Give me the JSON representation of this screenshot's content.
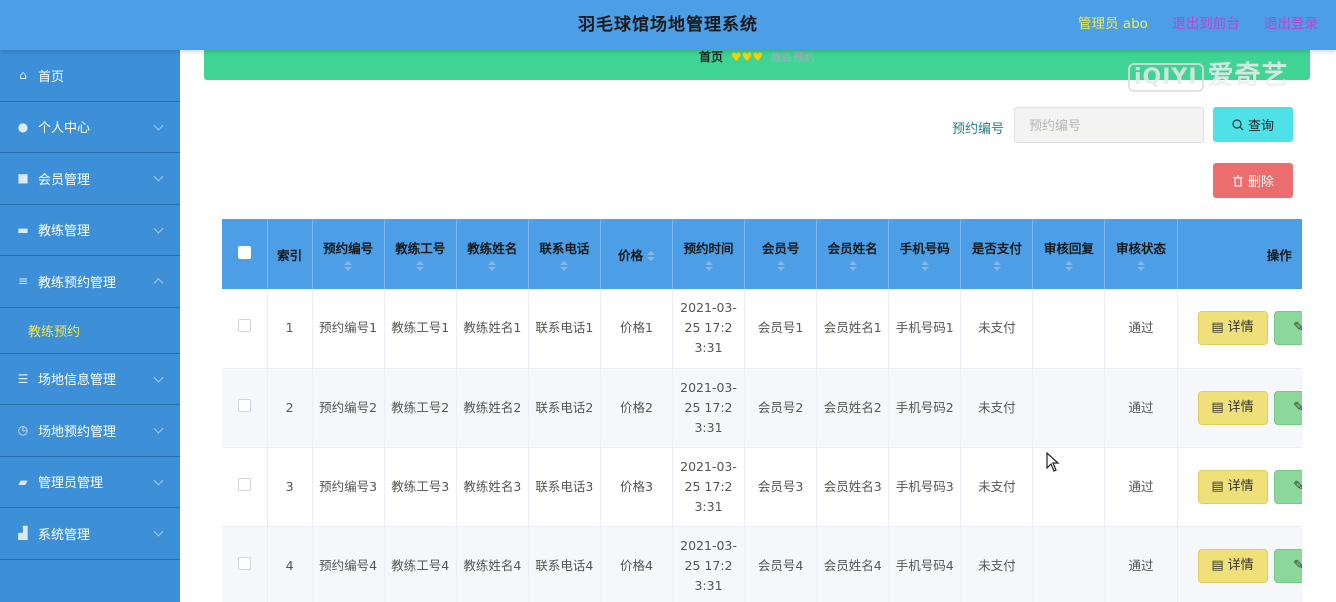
{
  "header": {
    "title": "羽毛球馆场地管理系统",
    "admin": "管理员 abo",
    "back_to_front": "退出到前台",
    "logout": "退出登录"
  },
  "watermark": {
    "box": "iQIYI",
    "text": "爱奇艺"
  },
  "sidebar": {
    "items": [
      {
        "label": "首页",
        "icon": "home-icon"
      },
      {
        "label": "个人中心",
        "icon": "user-icon"
      },
      {
        "label": "会员管理",
        "icon": "member-icon"
      },
      {
        "label": "教练管理",
        "icon": "coach-icon"
      },
      {
        "label": "教练预约管理",
        "icon": "list-icon"
      },
      {
        "label": "场地信息管理",
        "icon": "sliders-icon"
      },
      {
        "label": "场地预约管理",
        "icon": "clock-icon"
      },
      {
        "label": "管理员管理",
        "icon": "admin-icon"
      },
      {
        "label": "系统管理",
        "icon": "system-icon"
      }
    ],
    "submenu": {
      "label": "教练预约"
    }
  },
  "breadcrumb": {
    "home": "首页",
    "hearts": "♥♥♥",
    "current": "教练预约"
  },
  "search": {
    "label": "预约编号",
    "placeholder": "预约编号",
    "query": "查询",
    "delete": "删除"
  },
  "table": {
    "headers": [
      "索引",
      "预约编号",
      "教练工号",
      "教练姓名",
      "联系电话",
      "价格",
      "预约时间",
      "会员号",
      "会员姓名",
      "手机号码",
      "是否支付",
      "审核回复",
      "审核状态",
      "操作"
    ],
    "rows": [
      {
        "index": "1",
        "booking_no": "预约编号1",
        "coach_id": "教练工号1",
        "coach_name": "教练姓名1",
        "phone": "联系电话1",
        "price": "价格1",
        "time": "2021-03-25 17:23:31",
        "member_no": "会员号1",
        "member_name": "会员姓名1",
        "mobile": "手机号码1",
        "paid": "未支付",
        "reply": "",
        "status": "通过"
      },
      {
        "index": "2",
        "booking_no": "预约编号2",
        "coach_id": "教练工号2",
        "coach_name": "教练姓名2",
        "phone": "联系电话2",
        "price": "价格2",
        "time": "2021-03-25 17:23:31",
        "member_no": "会员号2",
        "member_name": "会员姓名2",
        "mobile": "手机号码2",
        "paid": "未支付",
        "reply": "",
        "status": "通过"
      },
      {
        "index": "3",
        "booking_no": "预约编号3",
        "coach_id": "教练工号3",
        "coach_name": "教练姓名3",
        "phone": "联系电话3",
        "price": "价格3",
        "time": "2021-03-25 17:23:31",
        "member_no": "会员号3",
        "member_name": "会员姓名3",
        "mobile": "手机号码3",
        "paid": "未支付",
        "reply": "",
        "status": "通过"
      },
      {
        "index": "4",
        "booking_no": "预约编号4",
        "coach_id": "教练工号4",
        "coach_name": "教练姓名4",
        "phone": "联系电话4",
        "price": "价格4",
        "time": "2021-03-25 17:23:31",
        "member_no": "会员号4",
        "member_name": "会员姓名4",
        "mobile": "手机号码4",
        "paid": "未支付",
        "reply": "",
        "status": "通过"
      }
    ],
    "detail_label": "详情"
  }
}
